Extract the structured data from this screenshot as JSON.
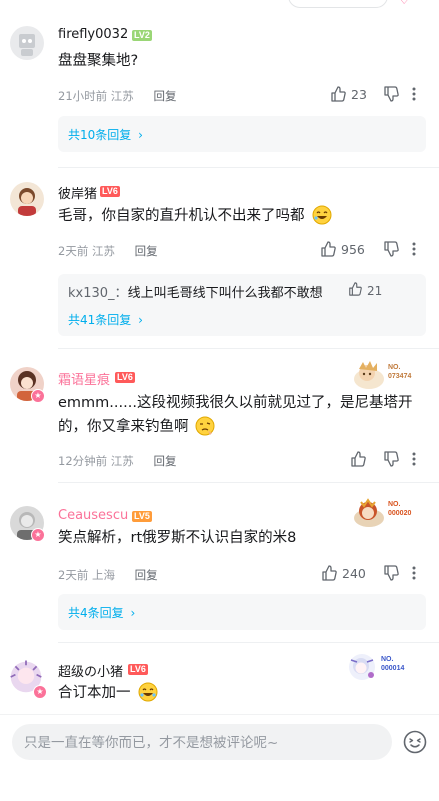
{
  "input": {
    "placeholder": "只是一直在等你而已，才不是想被评论呢~"
  },
  "comments": [
    {
      "username": "firefly0032",
      "level": "LV2",
      "name_color": "#61666d",
      "text": "盘盘聚集地?",
      "time": "21小时前",
      "location": "江苏",
      "reply_label": "回复",
      "likes": "23",
      "more_replies": "共10条回复"
    },
    {
      "username": "彼岸猪",
      "level": "LV6",
      "name_color": "#61666d",
      "text": "毛哥，你自家的直升机认不出来了吗都",
      "time": "2天前",
      "location": "江苏",
      "reply_label": "回复",
      "likes": "956",
      "sub": {
        "who": "kx130_",
        "sep": "：",
        "text": "线上叫毛哥线下叫什么我都不敢想",
        "likes": "21"
      },
      "more_replies": "共41条回复"
    },
    {
      "username": "霜语星痕",
      "level": "LV6",
      "name_color": "#fb7299",
      "text": "emmm......这段视频我很久以前就见过了，是尼基塔开的，你又拿来钓鱼啊",
      "time": "12分钟前",
      "location": "江苏",
      "reply_label": "回复",
      "likes": "",
      "fan": {
        "label": "NO.",
        "number": "073474",
        "color": "#c07a3b"
      }
    },
    {
      "username": "Ceausescu",
      "level": "LV5",
      "name_color": "#fb7299",
      "text": "笑点解析，rt俄罗斯不认识自家的米8",
      "time": "2天前",
      "location": "上海",
      "reply_label": "回复",
      "likes": "240",
      "fan": {
        "label": "NO.",
        "number": "000020",
        "color": "#d9541f"
      },
      "more_replies": "共4条回复"
    },
    {
      "username": "超级の小猪",
      "level": "LV6",
      "name_color": "#61666d",
      "text": "合订本加一",
      "fan": {
        "label": "NO.",
        "number": "000014",
        "color": "#3a57c9"
      }
    }
  ]
}
